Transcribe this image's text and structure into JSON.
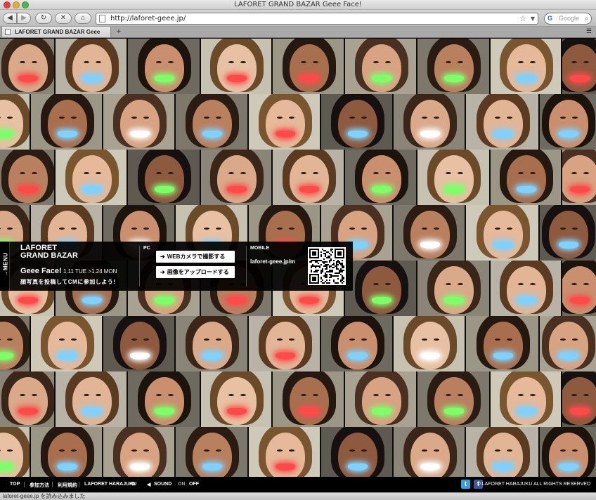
{
  "window": {
    "title": "LAFORET GRAND BAZAR Geee Face!"
  },
  "toolbar": {
    "back_icon": "◀",
    "forward_icon": "▶",
    "reload_icon": "↻",
    "stop_icon": "✕",
    "home_icon": "⌂",
    "url": "http://laforet-geee.jp/",
    "search_placeholder": "Google",
    "search_logo": "G"
  },
  "tabs": [
    {
      "label": "LAFORET GRAND BAZAR Geee Face!"
    }
  ],
  "tab_add_label": "+",
  "menu": {
    "tab_label": "→MENU",
    "brand_line1": "LAFORET",
    "brand_line2": "GRAND BAZAR",
    "campaign_title": "Geee Face!",
    "campaign_dates": "1.11 TUE >1.24 MON",
    "join_text": "顔写真を投稿してCMに参加しよう!",
    "pc_label": "PC",
    "webcam_button": "WEBカメラで撮影する",
    "upload_button": "画像をアップロードする",
    "mobile_label": "MOBILE",
    "mobile_url": "laforet-geee.jp/m"
  },
  "footer": {
    "top": "TOP",
    "how_to": "参加方法",
    "terms": "利用規約",
    "laforet_link": "LAFORET HARAJUKU",
    "sound_label": "SOUND",
    "sound_on": "ON",
    "sound_off": "OFF",
    "twitter_icon": "t",
    "facebook_icon": "f",
    "copyright": "© LAFORET HARAJUKU ALL RIGHTS RESERVED"
  },
  "status_text": "laforet-geee.jp を読み込みました",
  "colors": {
    "mouth_red": "#ff4a4a",
    "mouth_blue": "#7fd2ff",
    "mouth_green": "#7dff6a",
    "mouth_white": "#ffffff"
  },
  "face_rows": [
    {
      "mouths": [
        "red",
        "blue",
        "green",
        "red",
        "red",
        "green",
        "green",
        "blue",
        "red"
      ]
    },
    {
      "mouths": [
        "green",
        "blue",
        "white",
        "blue",
        "red",
        "blue",
        "white",
        "blue",
        "blue"
      ]
    },
    {
      "mouths": [
        "red",
        "blue",
        "green",
        "red",
        "red",
        "green",
        "green",
        "blue",
        "red"
      ]
    },
    {
      "mouths": [
        "green",
        "blue",
        "white",
        "blue",
        "red",
        "blue",
        "white",
        "blue",
        "blue"
      ]
    },
    {
      "mouths": [
        "red",
        "blue",
        "green",
        "red",
        "red",
        "green",
        "green",
        "blue",
        "red"
      ]
    },
    {
      "mouths": [
        "green",
        "blue",
        "white",
        "blue",
        "red",
        "blue",
        "white",
        "blue",
        "blue"
      ]
    },
    {
      "mouths": [
        "red",
        "blue",
        "green",
        "red",
        "red",
        "green",
        "green",
        "blue",
        "red"
      ]
    },
    {
      "mouths": [
        "green",
        "blue",
        "white",
        "blue",
        "red",
        "blue",
        "white",
        "blue",
        "blue"
      ]
    }
  ]
}
